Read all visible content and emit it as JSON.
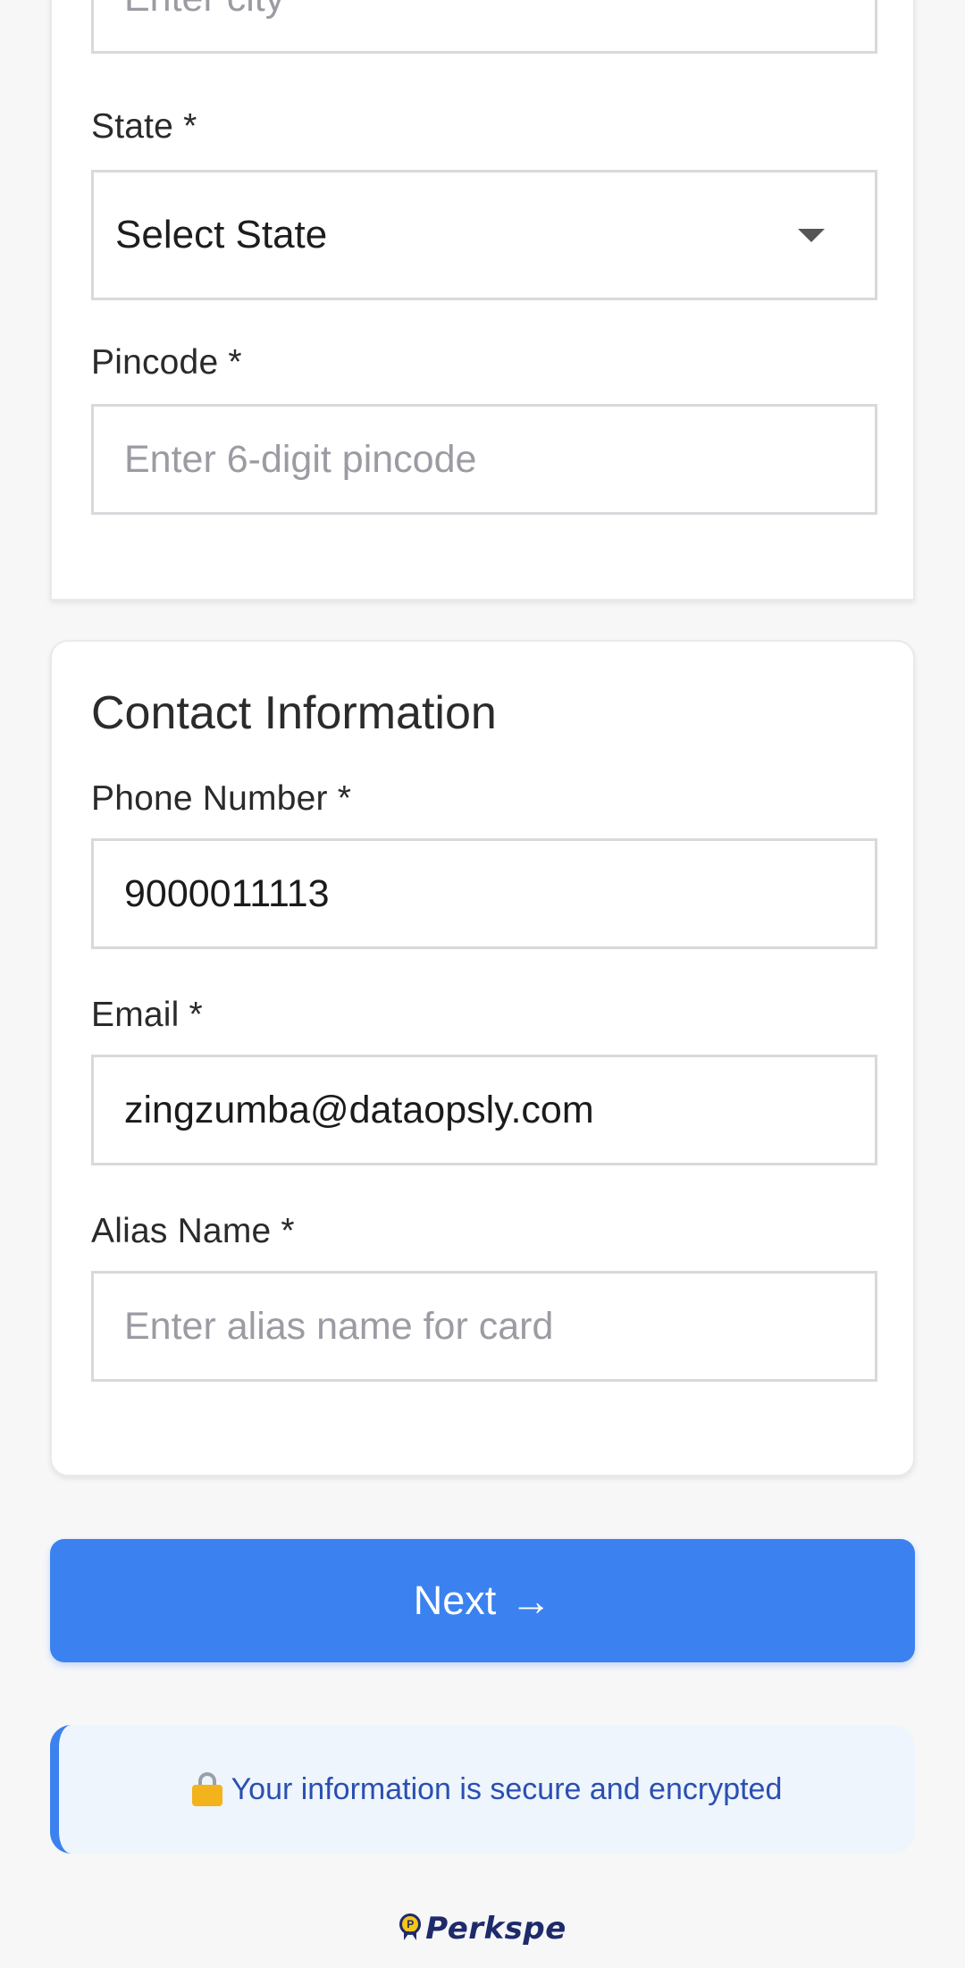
{
  "address": {
    "city_placeholder": "Enter city",
    "state_label": "State *",
    "state_selected": "Select State",
    "pincode_label": "Pincode *",
    "pincode_placeholder": "Enter 6-digit pincode"
  },
  "contact": {
    "title": "Contact Information",
    "phone_label": "Phone Number *",
    "phone_value": "9000011113",
    "email_label": "Email *",
    "email_value": "zingzumba@dataopsly.com",
    "alias_label": "Alias Name *",
    "alias_placeholder": "Enter alias name for card"
  },
  "actions": {
    "next_label": "Next",
    "next_arrow": "→"
  },
  "security_note": {
    "text": "Your information is secure and encrypted",
    "icon": "lock-icon"
  },
  "brand": {
    "name": "Perkspe",
    "coin_letter": "P"
  },
  "colors": {
    "primary": "#3b82f0",
    "note_bg": "#eef5fd",
    "note_text": "#2b4fb0",
    "brand": "#1f2a6b"
  }
}
